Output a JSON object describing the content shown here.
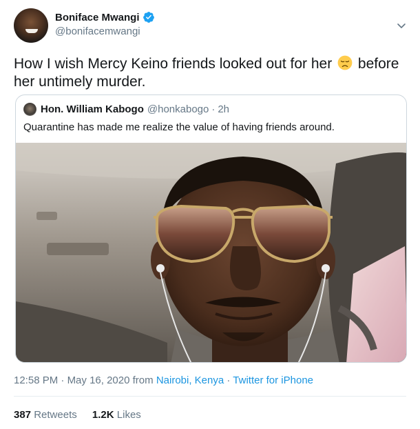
{
  "author": {
    "name": "Boniface Mwangi",
    "handle": "@bonifacemwangi",
    "verified": true
  },
  "tweet": {
    "text_before_emoji": "How I wish Mercy Keino friends looked out for her",
    "emoji": "disappointed-face",
    "text_after_emoji": "before her untimely murder."
  },
  "quoted_tweet": {
    "name": "Hon. William Kabogo",
    "handle": "@honkabogo",
    "separator": "·",
    "time": "2h",
    "text": "Quarantine has made me realize the value of having friends around."
  },
  "meta": {
    "time": "12:58 PM",
    "dot1": "·",
    "date": "May 16, 2020",
    "from": "from",
    "location": "Nairobi, Kenya",
    "dot2": "·",
    "source": "Twitter for iPhone"
  },
  "stats": {
    "retweets_count": "387",
    "retweets_label": "Retweets",
    "likes_count": "1.2K",
    "likes_label": "Likes"
  },
  "colors": {
    "link": "#1b95e0",
    "secondary_text": "#657786",
    "verified_badge": "#1da1f2"
  }
}
